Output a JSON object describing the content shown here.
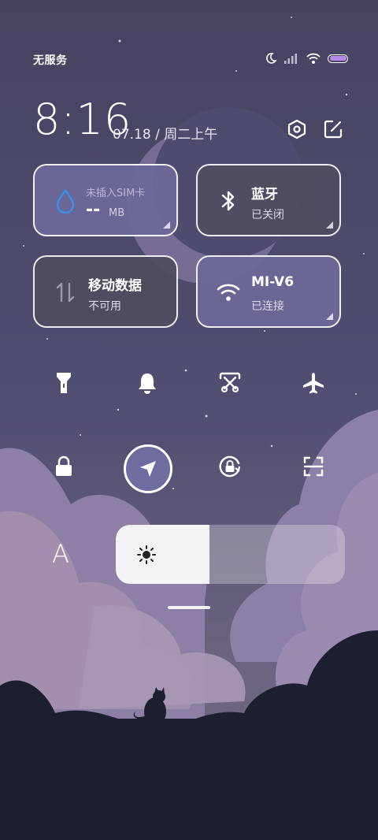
{
  "status_bar": {
    "carrier": "无服务"
  },
  "header": {
    "time": "8:16",
    "date": "07.18 / 周二上午"
  },
  "tiles": {
    "sim": {
      "label": "未插入SIM卡",
      "usage": "--",
      "unit": "MB"
    },
    "bluetooth": {
      "title": "蓝牙",
      "status": "已关闭"
    },
    "mobile_data": {
      "title": "移动数据",
      "status": "不可用"
    },
    "wifi": {
      "title": "MI-V6",
      "status": "已连接"
    }
  },
  "toggles_row1": [
    "flashlight-icon",
    "bell-icon",
    "screenshot-icon",
    "airplane-icon"
  ],
  "toggles_row2": [
    "lock-icon",
    "location-icon",
    "rotation-lock-icon",
    "scan-icon"
  ],
  "brightness": {
    "level": 0.41
  },
  "font_button": {
    "label": "A"
  },
  "colors": {
    "accent": "#6f6da0",
    "tile_dark": "#4e4d5f",
    "tile_light": "#6b6898",
    "sim_drop": "#3b8fe6"
  }
}
